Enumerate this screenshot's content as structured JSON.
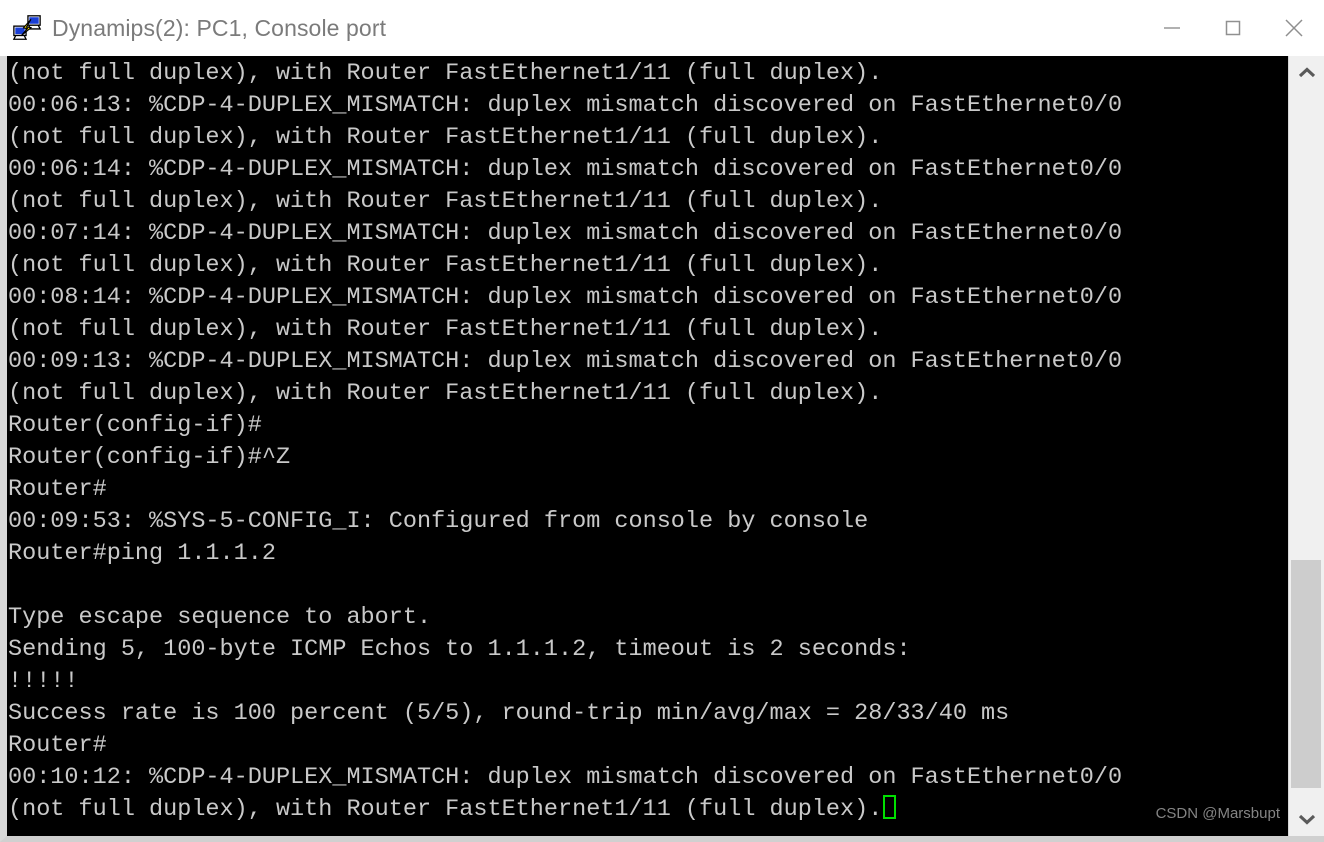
{
  "window": {
    "title": "Dynamips(2): PC1, Console port",
    "icon": "putty-console-icon",
    "controls": {
      "minimize": "minimize-button",
      "maximize": "maximize-button",
      "close": "close-button"
    }
  },
  "terminal": {
    "background": "#000000",
    "foreground": "#c9c9c9",
    "cursor_color": "#00e000",
    "cursor_style": "hollow-block",
    "lines": [
      "(not full duplex), with Router FastEthernet1/11 (full duplex).",
      "00:06:13: %CDP-4-DUPLEX_MISMATCH: duplex mismatch discovered on FastEthernet0/0",
      "(not full duplex), with Router FastEthernet1/11 (full duplex).",
      "00:06:14: %CDP-4-DUPLEX_MISMATCH: duplex mismatch discovered on FastEthernet0/0",
      "(not full duplex), with Router FastEthernet1/11 (full duplex).",
      "00:07:14: %CDP-4-DUPLEX_MISMATCH: duplex mismatch discovered on FastEthernet0/0",
      "(not full duplex), with Router FastEthernet1/11 (full duplex).",
      "00:08:14: %CDP-4-DUPLEX_MISMATCH: duplex mismatch discovered on FastEthernet0/0",
      "(not full duplex), with Router FastEthernet1/11 (full duplex).",
      "00:09:13: %CDP-4-DUPLEX_MISMATCH: duplex mismatch discovered on FastEthernet0/0",
      "(not full duplex), with Router FastEthernet1/11 (full duplex).",
      "Router(config-if)#",
      "Router(config-if)#^Z",
      "Router#",
      "00:09:53: %SYS-5-CONFIG_I: Configured from console by console",
      "Router#ping 1.1.1.2",
      "",
      "Type escape sequence to abort.",
      "Sending 5, 100-byte ICMP Echos to 1.1.1.2, timeout is 2 seconds:",
      "!!!!!",
      "Success rate is 100 percent (5/5), round-trip min/avg/max = 28/33/40 ms",
      "Router#",
      "00:10:12: %CDP-4-DUPLEX_MISMATCH: duplex mismatch discovered on FastEthernet0/0"
    ],
    "last_line_text": "(not full duplex), with Router FastEthernet1/11 (full duplex).",
    "cursor_line_index": 23
  },
  "scrollbar": {
    "up_arrow": "chevron-up-icon",
    "down_arrow": "chevron-down-icon",
    "thumb_top_pct": 66,
    "thumb_height_pct": 32
  },
  "watermark": {
    "text": "CSDN @Marsbupt"
  }
}
